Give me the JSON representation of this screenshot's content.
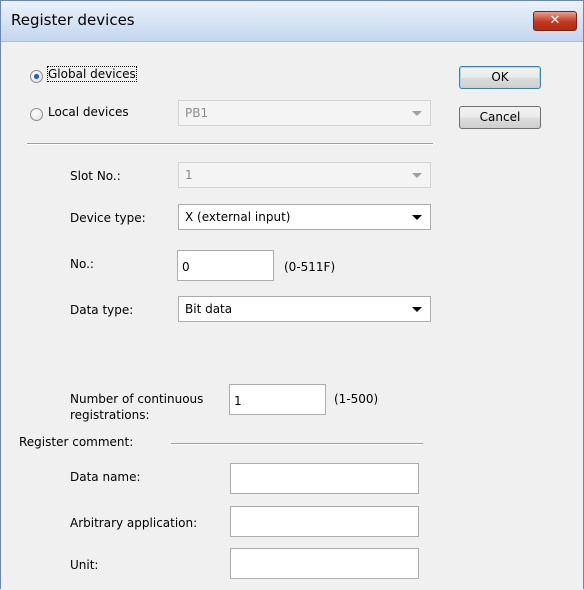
{
  "window": {
    "title": "Register devices"
  },
  "scope": {
    "global_label": "Global devices",
    "local_label": "Local devices",
    "local_value": "PB1",
    "selected": "global"
  },
  "buttons": {
    "ok": "OK",
    "cancel": "Cancel"
  },
  "slot": {
    "label": "Slot No.:",
    "value": "1"
  },
  "device_type": {
    "label": "Device type:",
    "value": "X (external input)"
  },
  "number": {
    "label": "No.:",
    "value": "0",
    "range": "(0-511F)"
  },
  "data_type": {
    "label": "Data type:",
    "value": "Bit data"
  },
  "continuous": {
    "label_line1": "Number of continuous",
    "label_line2": "registrations:",
    "value": "1",
    "range": "(1-500)"
  },
  "comment": {
    "section_label": "Register comment:",
    "data_name_label": "Data name:",
    "data_name_value": "",
    "arbitrary_label": "Arbitrary application:",
    "arbitrary_value": "",
    "unit_label": "Unit:",
    "unit_value": ""
  }
}
